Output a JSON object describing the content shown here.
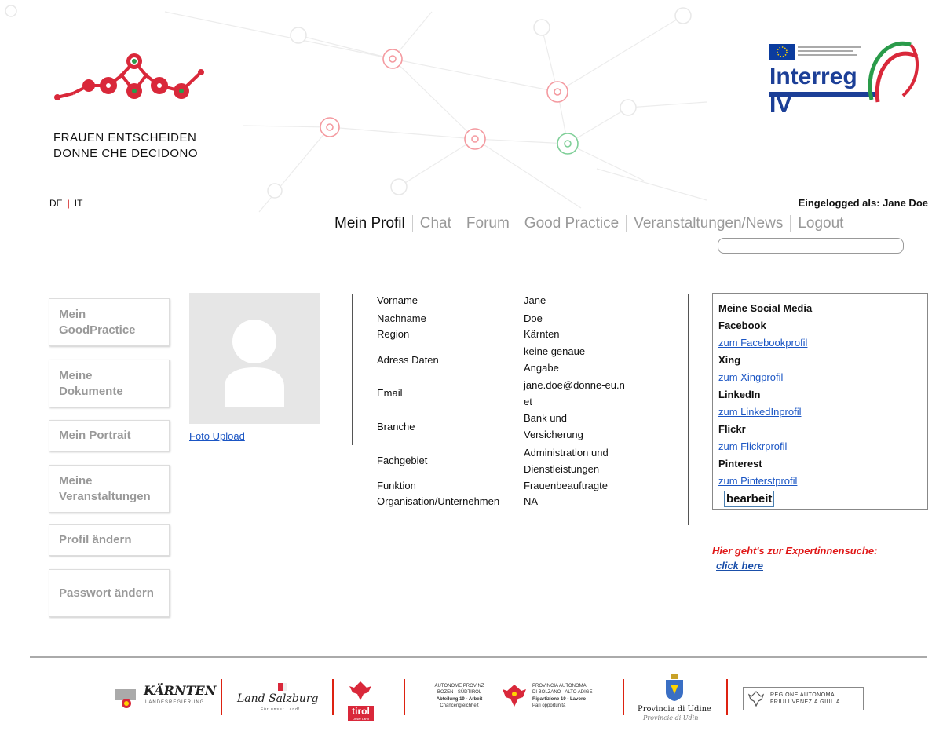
{
  "logo": {
    "line1": "FRAUEN ENTSCHEIDEN",
    "line2": "DONNE CHE DECIDONO"
  },
  "interreg": {
    "text": "Interreg IV"
  },
  "language": {
    "de": "DE",
    "sep": "|",
    "it": "IT"
  },
  "login": {
    "text": "Eingelogged als: Jane Doe"
  },
  "nav": [
    "Mein Profil",
    "Chat",
    "Forum",
    "Good Practice",
    "Veranstaltungen/News",
    "Logout"
  ],
  "sidebar": [
    "Mein GoodPractice",
    "Meine Dokumente",
    "Mein Portrait",
    "Meine Veranstaltungen",
    "Profil ändern",
    "Passwort ändern"
  ],
  "photo": {
    "upload": "Foto Upload"
  },
  "profile": [
    {
      "label": "Vorname",
      "value": "Jane"
    },
    {
      "label": "Nachname",
      "value": "Doe"
    },
    {
      "label": "Region",
      "value": "Kärnten"
    },
    {
      "label": "Adress Daten",
      "value": "keine genaue Angabe"
    },
    {
      "label": "Email",
      "value": "jane.doe@donne-eu.net"
    },
    {
      "label": "Branche",
      "value": "Bank und Versicherung"
    },
    {
      "label": "Fachgebiet",
      "value": "Administration und Dienstleistungen"
    },
    {
      "label": "Funktion",
      "value": "Frauenbeauftragte"
    },
    {
      "label": "Organisation/Unternehmen",
      "value": "NA"
    }
  ],
  "social": {
    "title": "Meine Social Media",
    "networks": [
      {
        "name": "Facebook",
        "link": "zum Facebookprofil"
      },
      {
        "name": "Xing",
        "link": "zum Xingprofil"
      },
      {
        "name": "LinkedIn",
        "link": "zum LinkedInprofil"
      },
      {
        "name": "Flickr",
        "link": "zum Flickrprofil"
      },
      {
        "name": "Pinterest",
        "link": "zum Pinterstprofil"
      }
    ],
    "edit": "bearbeit"
  },
  "expert": {
    "text": "Hier geht's zur Expertinnensuche:",
    "link": "click  here"
  },
  "footer": {
    "kaernten": "KÄRNTEN",
    "kaernten_sub": "LANDESREGIERUNG",
    "salzburg": "Land Salzburg",
    "salzburg_sub": "Für unser Land!",
    "tirol": "tirol",
    "tirol_sub": "Unser Land",
    "bz_de1": "AUTONOME PROVINZ",
    "bz_de2": "BOZEN - SÜDTIROL",
    "bz_de3": "Abteilung 19 - Arbeit",
    "bz_de4": "Chancengleichheit",
    "bz_it1": "PROVINCIA AUTONOMA",
    "bz_it2": "DI BOLZANO - ALTO ADIGE",
    "bz_it3": "Ripartizione 19 - Lavoro",
    "bz_it4": "Pari opportunità",
    "udine1": "Provincia di Udine",
    "udine2": "Provincie di Udin",
    "fvg1": "REGIONE AUTONOMA",
    "fvg2": "FRIULI VENEZIA GIULIA"
  },
  "colors": {
    "brand_red": "#d9283a",
    "brand_green": "#2a9b4a",
    "link": "#1a55c4"
  }
}
